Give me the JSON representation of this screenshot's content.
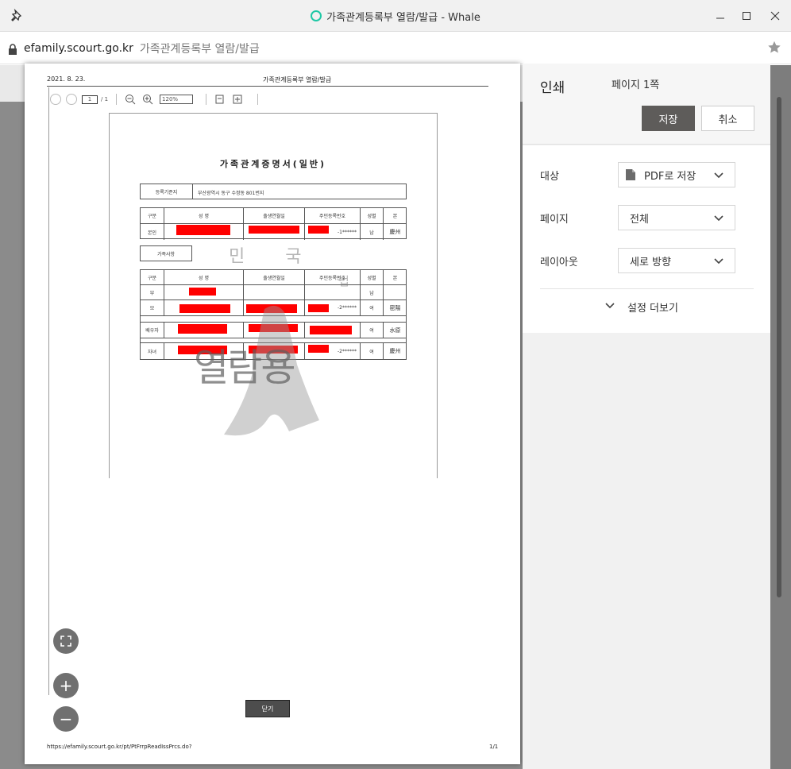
{
  "window": {
    "title": "가족관계등록부 열람/발급 - Whale"
  },
  "address": {
    "host": "efamily.scourt.go.kr",
    "title": "가족관계등록부 열람/발급"
  },
  "sheet": {
    "date": "2021. 8. 23.",
    "header_title": "가족관계등록부 열람/발급",
    "footer_url": "https://efamily.scourt.go.kr/pt/PtFrrpReadIssPrcs.do?",
    "footer_page": "1/1",
    "close_label": "닫기",
    "viewer": {
      "page": "1",
      "total": "/ 1",
      "zoom": "120%"
    },
    "doc": {
      "title": "가족관계증명서(일반)",
      "reg_label": "등록기준지",
      "reg_value": "부산광역시 동구 수정동 801번지",
      "headers": [
        "구분",
        "성    명",
        "출생연월일",
        "주민등록번호",
        "성별",
        "본"
      ],
      "self_label": "본인",
      "self_rrn_suffix": "-1******",
      "self_gender": "남",
      "self_origin": "慶州",
      "family_section": "가족사항",
      "rows": [
        {
          "rel": "부",
          "rrn": "",
          "gender": "남",
          "origin": ""
        },
        {
          "rel": "모",
          "rrn": "-2******",
          "gender": "여",
          "origin": "密陽"
        },
        {
          "rel": "배우자",
          "rrn": "",
          "gender": "여",
          "origin": "水原"
        },
        {
          "rel": "자녀",
          "rrn": "-2******",
          "gender": "여",
          "origin": "慶州"
        }
      ],
      "watermark_top": "민 국",
      "watermark_main": "열람용",
      "watermark_side": "법"
    }
  },
  "panel": {
    "title": "인쇄",
    "page_count": "페이지 1쪽",
    "save": "저장",
    "cancel": "취소",
    "dest_label": "대상",
    "dest_value": "PDF로 저장",
    "pages_label": "페이지",
    "pages_value": "전체",
    "layout_label": "레이아웃",
    "layout_value": "세로 방향",
    "more": "설정 더보기"
  },
  "fab": {
    "fullscreen": "fullscreen-icon",
    "zoom_in": "+",
    "zoom_out": "−"
  }
}
